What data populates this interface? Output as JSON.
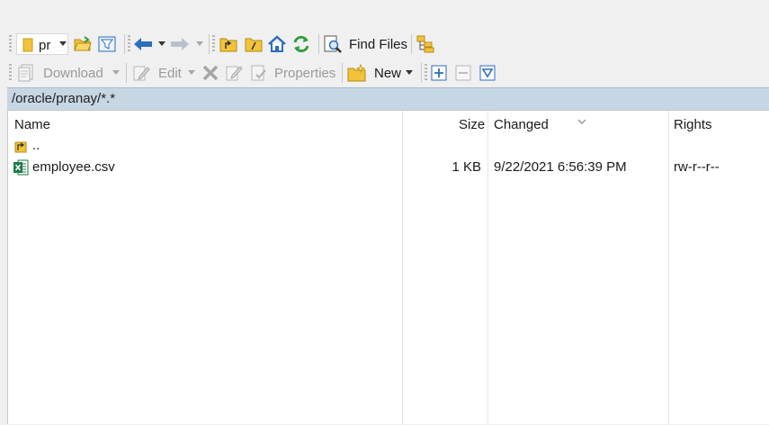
{
  "toolbar1": {
    "drive_label": "pr",
    "find_files_label": "Find Files"
  },
  "toolbar2": {
    "download_label": "Download",
    "edit_label": "Edit",
    "properties_label": "Properties",
    "new_label": "New"
  },
  "path": {
    "text": "/oracle/pranay/*.*"
  },
  "columns": {
    "name": "Name",
    "size": "Size",
    "changed": "Changed",
    "rights": "Rights"
  },
  "files": [
    {
      "name": "..",
      "size": "",
      "changed": "",
      "rights": "",
      "icon": "parent-folder-icon"
    },
    {
      "name": "employee.csv",
      "size": "1 KB",
      "changed": "9/22/2021 6:56:39 PM",
      "rights": "rw-r--r--",
      "icon": "excel-file-icon"
    }
  ],
  "colors": {
    "path_bar": "#c6d6e3",
    "accent_blue": "#2a6ebd",
    "folder_yellow": "#f2c33a",
    "refresh_green": "#2e9e3a"
  }
}
